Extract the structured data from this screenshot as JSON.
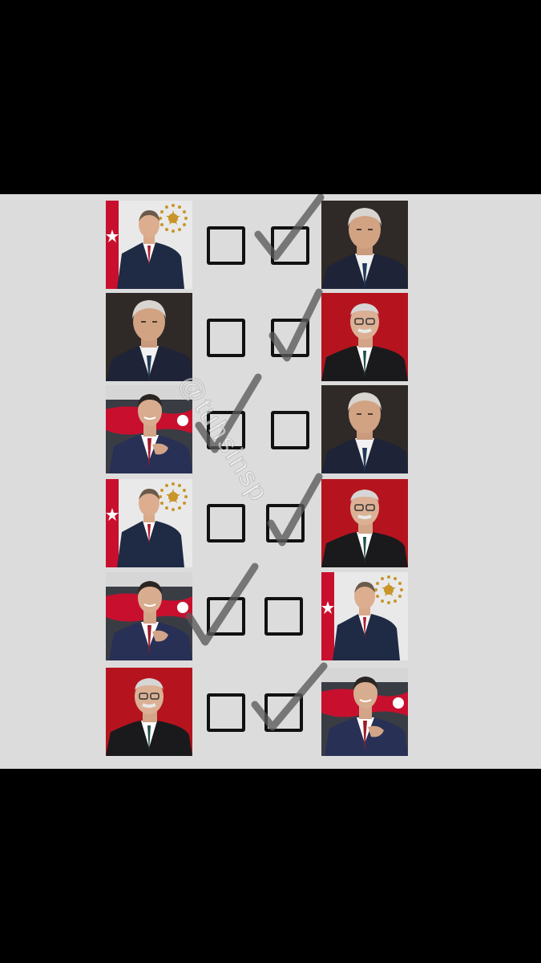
{
  "watermark": "@tuhsinsp",
  "colors": {
    "frame": "#000000",
    "panel": "#dcdcdc",
    "checkbox": "#111111",
    "check_mark": "#5a5a5a"
  },
  "rows": [
    {
      "left": "erdogan",
      "right": "ince",
      "checked": "right"
    },
    {
      "left": "ince",
      "right": "kilicdaroglu",
      "checked": "right"
    },
    {
      "left": "ogan",
      "right": "ince",
      "checked": "left"
    },
    {
      "left": "erdogan",
      "right": "kilicdaroglu",
      "checked": "right"
    },
    {
      "left": "ogan",
      "right": "erdogan",
      "checked": "left"
    },
    {
      "left": "kilicdaroglu",
      "right": "ogan",
      "checked": "right"
    }
  ]
}
